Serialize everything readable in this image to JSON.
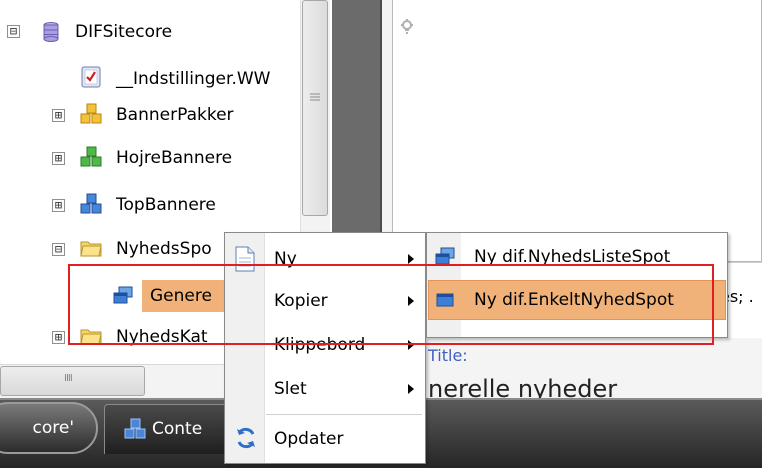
{
  "tree": {
    "items": [
      {
        "label": "DIFSitecore",
        "expander": "⊟",
        "icon": "database-icon"
      },
      {
        "label": "__Indstillinger.WW",
        "expander": "",
        "icon": "settings-item-icon"
      },
      {
        "label": "BannerPakker",
        "expander": "⊞",
        "icon": "yellow-cubes-icon"
      },
      {
        "label": "HojreBannere",
        "expander": "⊞",
        "icon": "green-cubes-icon"
      },
      {
        "label": "TopBannere",
        "expander": "⊞",
        "icon": "blue-cubes-icon"
      },
      {
        "label": "NyhedsSpo",
        "expander": "⊟",
        "icon": "folder-icon"
      },
      {
        "label": "Genere",
        "expander": "",
        "icon": "blue-windows-icon"
      },
      {
        "label": "NyhedsKat",
        "expander": "⊞",
        "icon": "folder-icon"
      }
    ],
    "h_scroll_grip": "IIII"
  },
  "context_menu": {
    "items": [
      {
        "label": "Ny",
        "has_submenu": true,
        "icon": "new-document-icon"
      },
      {
        "label": "Kopier",
        "has_submenu": true
      },
      {
        "label": "Klippebord",
        "has_submenu": true
      },
      {
        "label": "Slet",
        "has_submenu": true
      },
      {
        "label": "Opdater",
        "has_submenu": false,
        "icon": "refresh-icon"
      }
    ]
  },
  "submenu": {
    "items": [
      {
        "label": "Ny dif.NyhedsListeSpot",
        "icon": "blue-windows-icon",
        "highlighted": false
      },
      {
        "label": "Ny dif.EnkeltNyhedSpot",
        "icon": "blue-window-icon",
        "highlighted": true
      }
    ]
  },
  "content": {
    "field_suffix": "es; .",
    "title_label": "Title:",
    "title_value": "nerelle nyheder"
  },
  "taskbar": {
    "start_label": "core'",
    "task_label": "Conte"
  },
  "colors": {
    "highlight": "#f1b27a",
    "annotation": "#e02020",
    "taskbar": "#262626"
  }
}
